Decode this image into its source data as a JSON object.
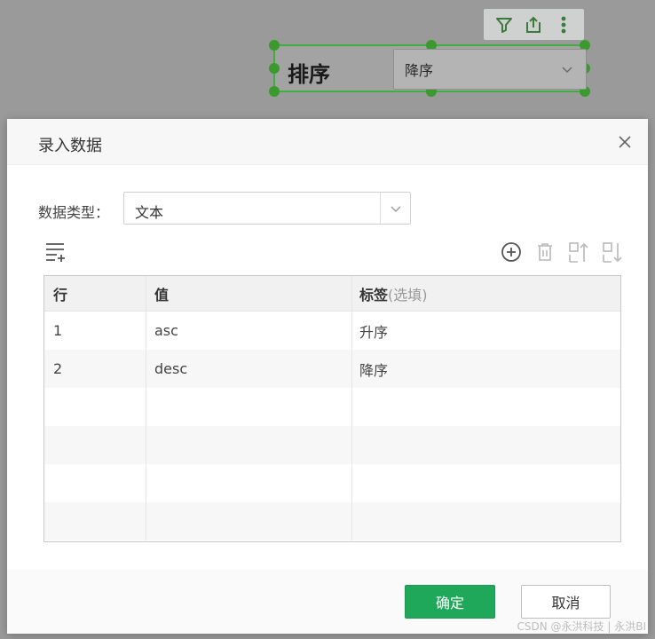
{
  "background_widget": {
    "title": "排序",
    "select_value": "降序",
    "toolbar_icons": [
      "filter-icon",
      "export-icon",
      "more-vertical-icon"
    ],
    "selection_color": "#3fae3f"
  },
  "dialog": {
    "title": "录入数据",
    "data_type_label": "数据类型：",
    "data_type_value": "文本",
    "toolbar_right_icons": [
      "add-circle-icon",
      "delete-icon",
      "move-up-icon",
      "move-down-icon"
    ],
    "table": {
      "headers": {
        "row": "行",
        "value": "值",
        "label": "标签",
        "label_hint": "(选填)"
      },
      "rows": [
        {
          "row": "1",
          "value": "asc",
          "label": "升序"
        },
        {
          "row": "2",
          "value": "desc",
          "label": "降序"
        },
        {
          "row": "",
          "value": "",
          "label": ""
        },
        {
          "row": "",
          "value": "",
          "label": ""
        },
        {
          "row": "",
          "value": "",
          "label": ""
        },
        {
          "row": "",
          "value": "",
          "label": ""
        }
      ]
    },
    "ok_label": "确定",
    "cancel_label": "取消"
  },
  "watermark": "CSDN @永洪科技 | 永洪BI",
  "colors": {
    "primary_green": "#1fa85a",
    "overlay": "#9a9a9a"
  }
}
